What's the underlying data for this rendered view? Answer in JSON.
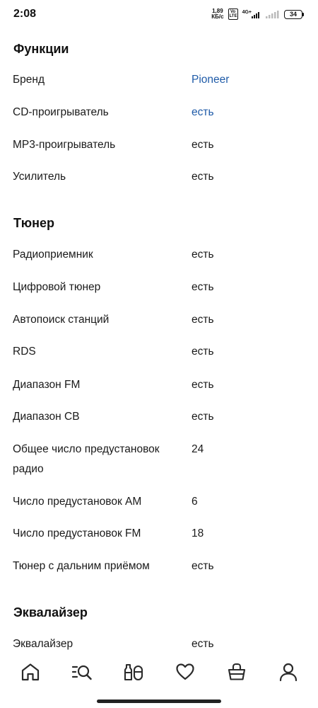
{
  "status_bar": {
    "time": "2:08",
    "net_speed_value": "1,89",
    "net_speed_unit": "КБ/с",
    "volte": "Vo LTE",
    "network": "4G+",
    "battery": "34"
  },
  "sections": [
    {
      "title": "Функции",
      "rows": [
        {
          "label": "Бренд",
          "value": "Pioneer",
          "link": true
        },
        {
          "label": "CD-проигрыватель",
          "value": "есть",
          "link": true
        },
        {
          "label": "MP3-проигрыватель",
          "value": "есть"
        },
        {
          "label": "Усилитель",
          "value": "есть"
        }
      ]
    },
    {
      "title": "Тюнер",
      "rows": [
        {
          "label": "Радиоприемник",
          "value": "есть"
        },
        {
          "label": "Цифровой тюнер",
          "value": "есть"
        },
        {
          "label": "Автопоиск станций",
          "value": "есть"
        },
        {
          "label": "RDS",
          "value": "есть"
        },
        {
          "label": "Диапазон FM",
          "value": "есть"
        },
        {
          "label": "Диапазон СВ",
          "value": "есть"
        },
        {
          "label": "Общее число предустановок радио",
          "value": "24"
        },
        {
          "label": "Число предустановок AM",
          "value": "6"
        },
        {
          "label": "Число предустановок FM",
          "value": "18"
        },
        {
          "label": "Тюнер с дальним приёмом",
          "value": "есть"
        }
      ]
    },
    {
      "title": "Эквалайзер",
      "rows": [
        {
          "label": "Эквалайзер",
          "value": "есть"
        }
      ]
    }
  ],
  "bottom_nav": [
    {
      "icon": "home-icon"
    },
    {
      "icon": "catalog-search-icon"
    },
    {
      "icon": "products-icon"
    },
    {
      "icon": "favorites-heart-icon"
    },
    {
      "icon": "cart-icon"
    },
    {
      "icon": "profile-icon"
    }
  ],
  "colors": {
    "link": "#1f5ba8",
    "text": "#1a1a1a",
    "icon": "#2a2a2a"
  }
}
